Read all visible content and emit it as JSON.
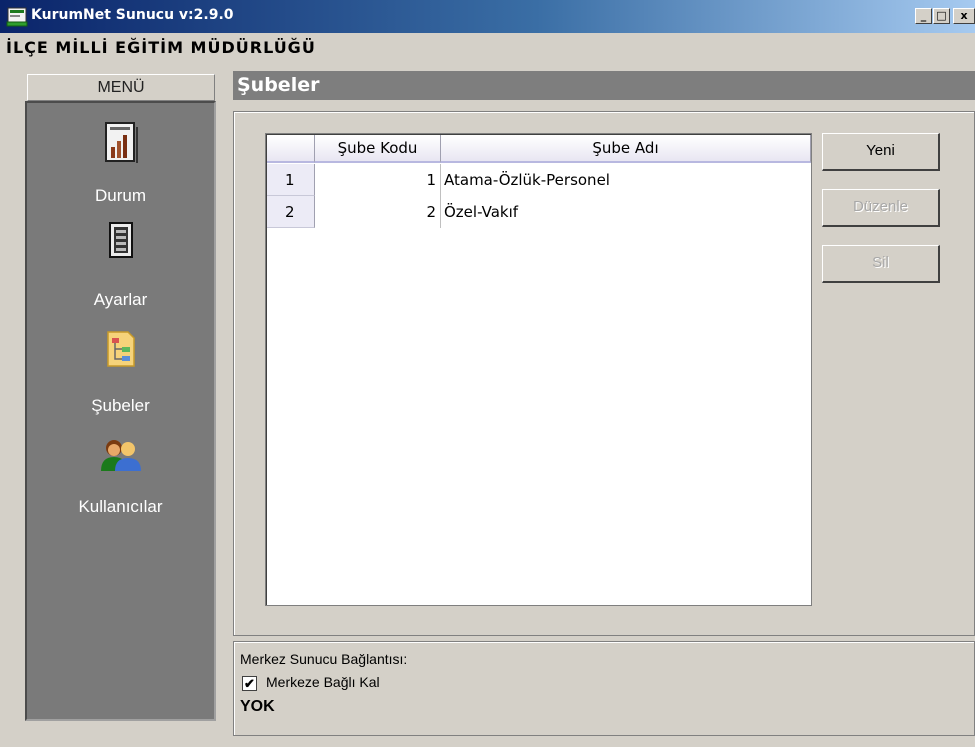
{
  "window": {
    "title": "KurumNet Sunucu v:2.9.0",
    "controls": {
      "minimize": "_",
      "maximize": "□",
      "close": "x"
    }
  },
  "organization": "İLÇE MİLLİ EĞİTİM MÜDÜRLÜĞÜ",
  "sidebar": {
    "header": "MENÜ",
    "items": [
      {
        "label": "Durum",
        "icon": "chart-document-icon"
      },
      {
        "label": "Ayarlar",
        "icon": "settings-document-icon"
      },
      {
        "label": "Şubeler",
        "icon": "org-chart-icon"
      },
      {
        "label": "Kullanıcılar",
        "icon": "users-icon"
      }
    ]
  },
  "main": {
    "title": "Şubeler",
    "table": {
      "columns": [
        "",
        "Şube Kodu",
        "Şube Adı"
      ],
      "rows": [
        {
          "index": "1",
          "code": "1",
          "name": "Atama-Özlük-Personel"
        },
        {
          "index": "2",
          "code": "2",
          "name": "Özel-Vakıf"
        }
      ]
    },
    "buttons": {
      "new": "Yeni",
      "edit": "Düzenle",
      "delete": "Sil"
    }
  },
  "status": {
    "title": "Merkez Sunucu Bağlantısı:",
    "checkbox_label": "Merkeze Bağlı Kal",
    "checkbox_checked": true,
    "value": "YOK"
  }
}
